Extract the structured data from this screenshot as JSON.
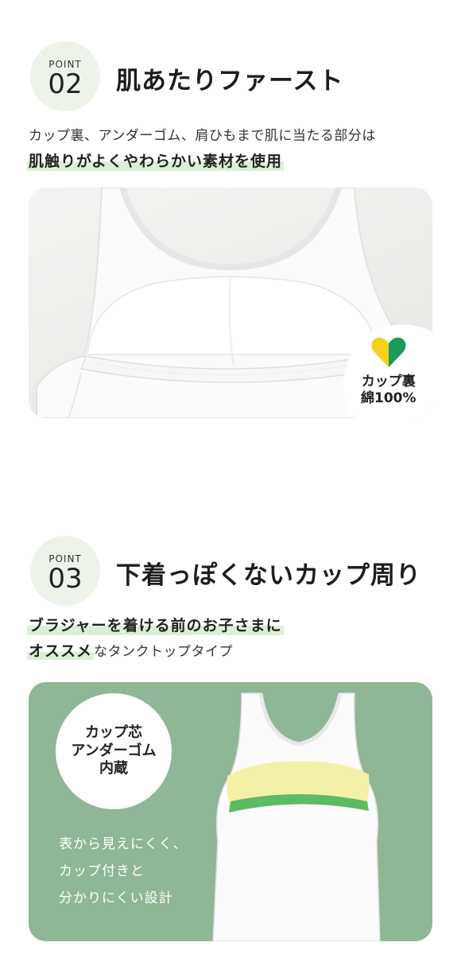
{
  "point02": {
    "label": "POINT",
    "number": "02",
    "heading": "肌あたりファースト",
    "line1": "カップ裏、アンダーゴム、肩ひもまで肌に当たる部分は",
    "line2": "肌触りがよくやわらかい素材を使用",
    "badge_line1": "カップ裏",
    "badge_line2": "綿100%",
    "badge_icon": "heart-icon"
  },
  "point03": {
    "label": "POINT",
    "number": "03",
    "heading": "下着っぽくないカップ周り",
    "line1": "ブラジャーを着ける前のお子さまに",
    "line2_bold": "オススメ",
    "line2_normal": "なタンクトップタイプ",
    "badge_line1": "カップ芯",
    "badge_line2": "アンダーゴム",
    "badge_line3": "内蔵",
    "overlay_line1": "表から見えにくく、",
    "overlay_line2": "カップ付きと",
    "overlay_line3": "分かりにくい設計"
  },
  "colors": {
    "accent_green": "#5dbb63",
    "heart_yellow": "#f2d21b",
    "heart_green": "#1a9b5a",
    "cup_yellow": "#f3f0a8",
    "photo2_bg": "#8fb697"
  }
}
